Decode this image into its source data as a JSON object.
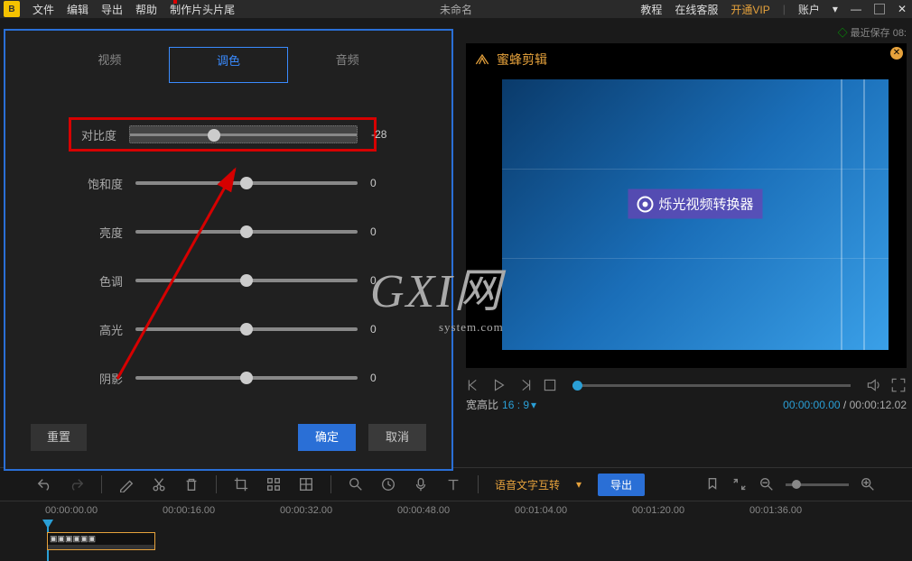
{
  "topbar": {
    "menus": [
      "文件",
      "编辑",
      "导出",
      "帮助",
      "制作片头片尾"
    ],
    "title": "未命名",
    "right": {
      "tutorial": "教程",
      "service": "在线客服",
      "vip": "开通VIP",
      "account": "账户"
    },
    "save_status": "最近保存 08:"
  },
  "tabs": {
    "video": "视频",
    "color": "调色",
    "audio": "音频"
  },
  "sliders": {
    "contrast": {
      "label": "对比度",
      "value": "-28",
      "pos": 37
    },
    "saturation": {
      "label": "饱和度",
      "value": "0",
      "pos": 50
    },
    "brightness": {
      "label": "亮度",
      "value": "0",
      "pos": 50
    },
    "hue": {
      "label": "色调",
      "value": "0",
      "pos": 50
    },
    "highlight": {
      "label": "高光",
      "value": "0",
      "pos": 50
    },
    "shadow": {
      "label": "阴影",
      "value": "0",
      "pos": 50
    }
  },
  "buttons": {
    "reset": "重置",
    "confirm": "确定",
    "cancel": "取消"
  },
  "preview": {
    "app_title": "蜜蜂剪辑",
    "overlay_app": "烁光视频转换器",
    "aspect_label": "宽高比",
    "aspect_value": "16 : 9",
    "time_current": "00:00:00.00",
    "time_total": "00:00:12.02"
  },
  "watermark": {
    "big": "GXI网",
    "small": "system.com"
  },
  "toolbar": {
    "voice_text": "语音文字互转",
    "export": "导出"
  },
  "timeline": {
    "marks": [
      "00:00:00.00",
      "00:00:16.00",
      "00:00:32.00",
      "00:00:48.00",
      "00:01:04.00",
      "00:01:20.00",
      "00:01:36.00"
    ]
  }
}
